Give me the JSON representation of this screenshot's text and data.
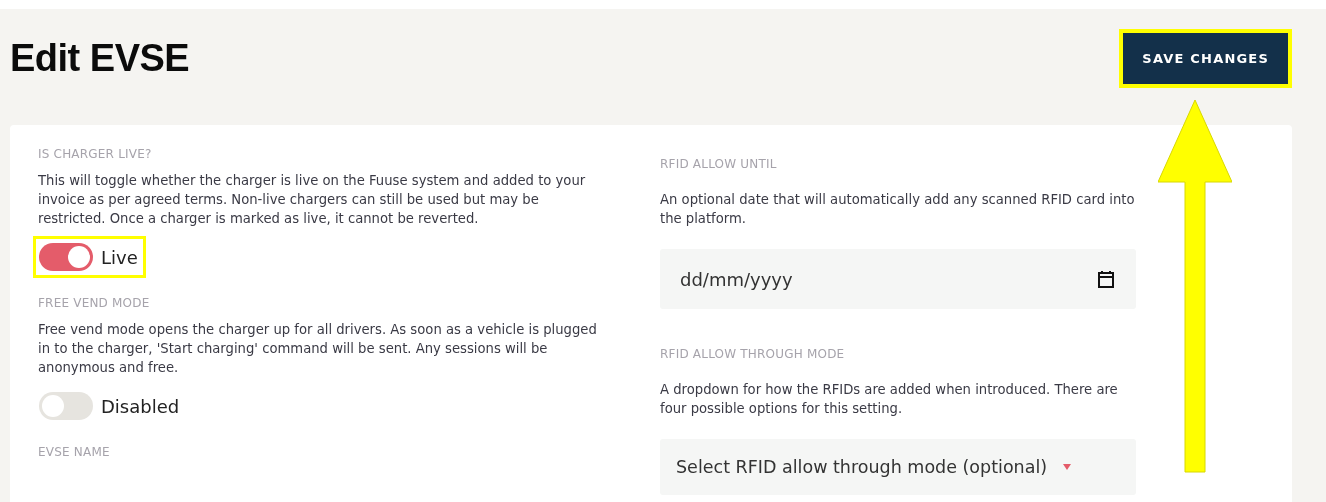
{
  "title": "Edit EVSE",
  "save_button": {
    "label": "SAVE CHANGES",
    "highlighted": true
  },
  "pointer_arrow": true,
  "left_column": [
    {
      "kind": "toggle",
      "label": "IS CHARGER LIVE?",
      "description": "This will toggle whether the charger is live on the Fuuse system and added to your invoice as per agreed terms. Non-live chargers can still be used but may be restricted. Once a charger is marked as live, it cannot be reverted.",
      "on": true,
      "state_text": "Live",
      "highlighted": true
    },
    {
      "kind": "toggle",
      "label": "FREE VEND MODE",
      "description": "Free vend mode opens the charger up for all drivers. As soon as a vehicle is plugged in to the charger, 'Start charging' command will be sent. Any sessions will be anonymous and free.",
      "on": false,
      "state_text": "Disabled",
      "highlighted": false
    },
    {
      "kind": "heading",
      "label": "EVSE NAME"
    }
  ],
  "right_column": [
    {
      "kind": "date",
      "label": "RFID ALLOW UNTIL",
      "description": "An optional date that will automatically add any scanned RFID card into the platform.",
      "placeholder": "dd/mm/yyyy"
    },
    {
      "kind": "select",
      "label": "RFID ALLOW THROUGH MODE",
      "description": "A dropdown for how the RFIDs are added when introduced. There are four possible options for this setting.",
      "value": "Select RFID allow through mode (optional)"
    }
  ]
}
